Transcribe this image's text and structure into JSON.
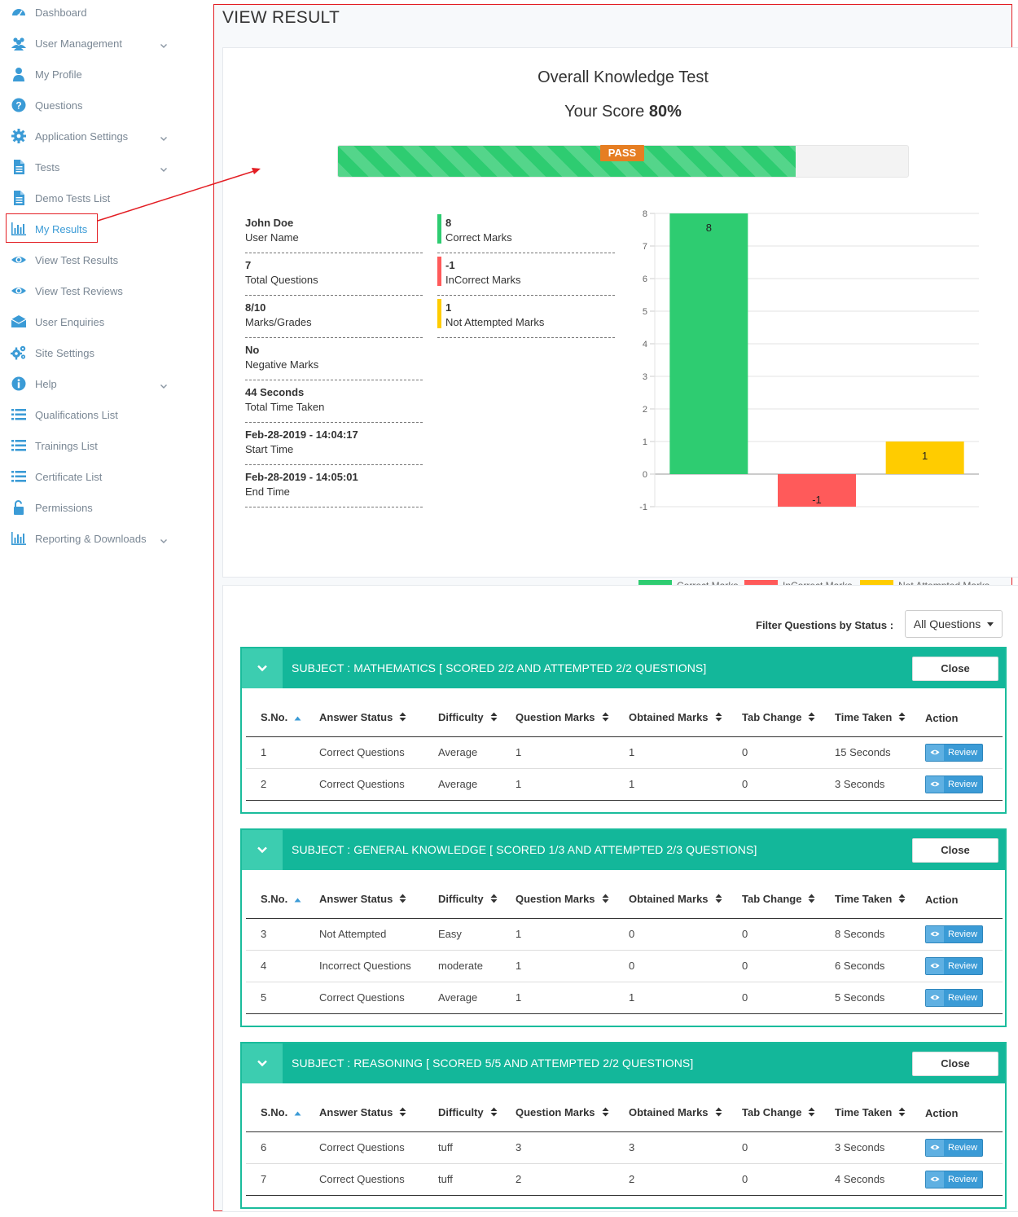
{
  "sidebar": {
    "items": [
      {
        "label": "Dashboard",
        "icon": "dashboard-icon",
        "chevron": false
      },
      {
        "label": "User Management",
        "icon": "users-icon",
        "chevron": true
      },
      {
        "label": "My Profile",
        "icon": "user-icon",
        "chevron": false
      },
      {
        "label": "Questions",
        "icon": "question-circle-icon",
        "chevron": false
      },
      {
        "label": "Application Settings",
        "icon": "gear-icon",
        "chevron": true
      },
      {
        "label": "Tests",
        "icon": "file-icon",
        "chevron": true
      },
      {
        "label": "Demo Tests List",
        "icon": "file-icon",
        "chevron": false
      },
      {
        "label": "My Results",
        "icon": "bar-chart-icon",
        "chevron": false,
        "active": true
      },
      {
        "label": "View Test Results",
        "icon": "eye-icon",
        "chevron": false
      },
      {
        "label": "View Test Reviews",
        "icon": "eye-icon",
        "chevron": false
      },
      {
        "label": "User Enquiries",
        "icon": "envelope-icon",
        "chevron": false
      },
      {
        "label": "Site Settings",
        "icon": "gears-icon",
        "chevron": false
      },
      {
        "label": "Help",
        "icon": "info-circle-icon",
        "chevron": true
      },
      {
        "label": "Qualifications List",
        "icon": "list-icon",
        "chevron": false
      },
      {
        "label": "Trainings List",
        "icon": "list-icon",
        "chevron": false
      },
      {
        "label": "Certificate List",
        "icon": "list-icon",
        "chevron": false
      },
      {
        "label": "Permissions",
        "icon": "unlock-icon",
        "chevron": false
      },
      {
        "label": "Reporting & Downloads",
        "icon": "bar-chart-icon",
        "chevron": true
      }
    ]
  },
  "page": {
    "title": "VIEW RESULT"
  },
  "result": {
    "test_name": "Overall Knowledge Test",
    "score_prefix": "Your Score",
    "score": "80%",
    "progress_percent": 80,
    "badge": "PASS",
    "info": [
      {
        "value": "John Doe",
        "label": "User Name"
      },
      {
        "value": "7",
        "label": "Total Questions"
      },
      {
        "value": "8/10",
        "label": "Marks/Grades"
      },
      {
        "value": "No",
        "label": "Negative Marks"
      },
      {
        "value": "44 Seconds",
        "label": "Total Time Taken"
      },
      {
        "value": "Feb-28-2019 - 14:04:17",
        "label": "Start Time"
      },
      {
        "value": "Feb-28-2019 - 14:05:01",
        "label": "End Time"
      }
    ],
    "marks": [
      {
        "value": "8",
        "label": "Correct Marks",
        "color": "#2ecc71"
      },
      {
        "value": "-1",
        "label": "InCorrect Marks",
        "color": "#ff5a5a"
      },
      {
        "value": "1",
        "label": "Not Attempted Marks",
        "color": "#ffcc00"
      }
    ]
  },
  "chart_data": {
    "type": "bar",
    "categories": [
      "Correct Marks",
      "InCorrect Marks",
      "Not Attempted Marks"
    ],
    "values": [
      8,
      -1,
      1
    ],
    "colors": [
      "#2ecc71",
      "#ff5a5a",
      "#ffcc00"
    ],
    "data_labels": [
      "8",
      "-1",
      "1"
    ],
    "ylim": [
      -1,
      8
    ],
    "yticks": [
      "-1",
      "0",
      "1",
      "2",
      "3",
      "4",
      "5",
      "6",
      "7",
      "8"
    ],
    "grid": true,
    "legend": "bottom",
    "legend_entries": [
      "Correct Marks",
      "InCorrect Marks",
      "Not Attempted Marks"
    ]
  },
  "filter": {
    "label": "Filter Questions by Status :",
    "selected": "All Questions"
  },
  "columns": [
    "S.No.",
    "Answer Status",
    "Difficulty",
    "Question Marks",
    "Obtained Marks",
    "Tab Change",
    "Time Taken",
    "Action"
  ],
  "subjects": [
    {
      "title": "SUBJECT : MATHEMATICS [ SCORED 2/2 AND ATTEMPTED 2/2 QUESTIONS]",
      "close_label": "Close",
      "rows": [
        {
          "sno": "1",
          "status": "Correct Questions",
          "difficulty": "Average",
          "qmarks": "1",
          "omarks": "1",
          "tab": "0",
          "time": "15 Seconds",
          "action": "Review"
        },
        {
          "sno": "2",
          "status": "Correct Questions",
          "difficulty": "Average",
          "qmarks": "1",
          "omarks": "1",
          "tab": "0",
          "time": "3 Seconds",
          "action": "Review"
        }
      ]
    },
    {
      "title": "SUBJECT : GENERAL KNOWLEDGE [ SCORED 1/3 AND ATTEMPTED 2/3 QUESTIONS]",
      "close_label": "Close",
      "rows": [
        {
          "sno": "3",
          "status": "Not Attempted",
          "difficulty": "Easy",
          "qmarks": "1",
          "omarks": "0",
          "tab": "0",
          "time": "8 Seconds",
          "action": "Review"
        },
        {
          "sno": "4",
          "status": "Incorrect Questions",
          "difficulty": "moderate",
          "qmarks": "1",
          "omarks": "0",
          "tab": "0",
          "time": "6 Seconds",
          "action": "Review"
        },
        {
          "sno": "5",
          "status": "Correct Questions",
          "difficulty": "Average",
          "qmarks": "1",
          "omarks": "1",
          "tab": "0",
          "time": "5 Seconds",
          "action": "Review"
        }
      ]
    },
    {
      "title": "SUBJECT : REASONING [ SCORED 5/5 AND ATTEMPTED 2/2 QUESTIONS]",
      "close_label": "Close",
      "rows": [
        {
          "sno": "6",
          "status": "Correct Questions",
          "difficulty": "tuff",
          "qmarks": "3",
          "omarks": "3",
          "tab": "0",
          "time": "3 Seconds",
          "action": "Review"
        },
        {
          "sno": "7",
          "status": "Correct Questions",
          "difficulty": "tuff",
          "qmarks": "2",
          "omarks": "2",
          "tab": "0",
          "time": "4 Seconds",
          "action": "Review"
        }
      ]
    }
  ]
}
